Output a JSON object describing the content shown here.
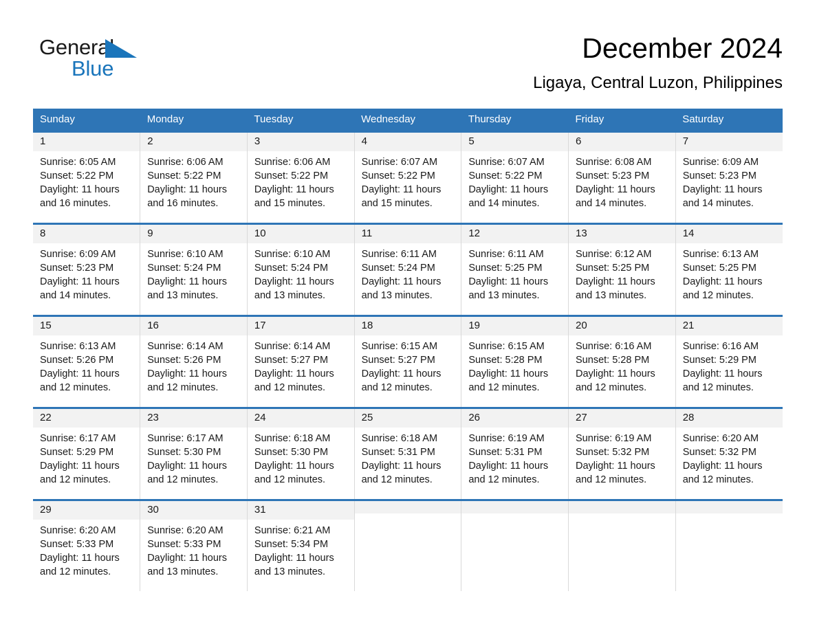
{
  "logo": {
    "word1": "General",
    "word2": "Blue",
    "triangle_color": "#1a75bb",
    "text_color": "#1a1a1a"
  },
  "header": {
    "month_title": "December 2024",
    "location": "Ligaya, Central Luzon, Philippines"
  },
  "colors": {
    "header_blue": "#2e75b6",
    "date_band_gray": "#f2f2f2",
    "cell_border": "#d9d9d9"
  },
  "calendar": {
    "day_headers": [
      "Sunday",
      "Monday",
      "Tuesday",
      "Wednesday",
      "Thursday",
      "Friday",
      "Saturday"
    ],
    "weeks": [
      [
        {
          "date": "1",
          "sunrise": "Sunrise: 6:05 AM",
          "sunset": "Sunset: 5:22 PM",
          "daylight_l1": "Daylight: 11 hours",
          "daylight_l2": "and 16 minutes."
        },
        {
          "date": "2",
          "sunrise": "Sunrise: 6:06 AM",
          "sunset": "Sunset: 5:22 PM",
          "daylight_l1": "Daylight: 11 hours",
          "daylight_l2": "and 16 minutes."
        },
        {
          "date": "3",
          "sunrise": "Sunrise: 6:06 AM",
          "sunset": "Sunset: 5:22 PM",
          "daylight_l1": "Daylight: 11 hours",
          "daylight_l2": "and 15 minutes."
        },
        {
          "date": "4",
          "sunrise": "Sunrise: 6:07 AM",
          "sunset": "Sunset: 5:22 PM",
          "daylight_l1": "Daylight: 11 hours",
          "daylight_l2": "and 15 minutes."
        },
        {
          "date": "5",
          "sunrise": "Sunrise: 6:07 AM",
          "sunset": "Sunset: 5:22 PM",
          "daylight_l1": "Daylight: 11 hours",
          "daylight_l2": "and 14 minutes."
        },
        {
          "date": "6",
          "sunrise": "Sunrise: 6:08 AM",
          "sunset": "Sunset: 5:23 PM",
          "daylight_l1": "Daylight: 11 hours",
          "daylight_l2": "and 14 minutes."
        },
        {
          "date": "7",
          "sunrise": "Sunrise: 6:09 AM",
          "sunset": "Sunset: 5:23 PM",
          "daylight_l1": "Daylight: 11 hours",
          "daylight_l2": "and 14 minutes."
        }
      ],
      [
        {
          "date": "8",
          "sunrise": "Sunrise: 6:09 AM",
          "sunset": "Sunset: 5:23 PM",
          "daylight_l1": "Daylight: 11 hours",
          "daylight_l2": "and 14 minutes."
        },
        {
          "date": "9",
          "sunrise": "Sunrise: 6:10 AM",
          "sunset": "Sunset: 5:24 PM",
          "daylight_l1": "Daylight: 11 hours",
          "daylight_l2": "and 13 minutes."
        },
        {
          "date": "10",
          "sunrise": "Sunrise: 6:10 AM",
          "sunset": "Sunset: 5:24 PM",
          "daylight_l1": "Daylight: 11 hours",
          "daylight_l2": "and 13 minutes."
        },
        {
          "date": "11",
          "sunrise": "Sunrise: 6:11 AM",
          "sunset": "Sunset: 5:24 PM",
          "daylight_l1": "Daylight: 11 hours",
          "daylight_l2": "and 13 minutes."
        },
        {
          "date": "12",
          "sunrise": "Sunrise: 6:11 AM",
          "sunset": "Sunset: 5:25 PM",
          "daylight_l1": "Daylight: 11 hours",
          "daylight_l2": "and 13 minutes."
        },
        {
          "date": "13",
          "sunrise": "Sunrise: 6:12 AM",
          "sunset": "Sunset: 5:25 PM",
          "daylight_l1": "Daylight: 11 hours",
          "daylight_l2": "and 13 minutes."
        },
        {
          "date": "14",
          "sunrise": "Sunrise: 6:13 AM",
          "sunset": "Sunset: 5:25 PM",
          "daylight_l1": "Daylight: 11 hours",
          "daylight_l2": "and 12 minutes."
        }
      ],
      [
        {
          "date": "15",
          "sunrise": "Sunrise: 6:13 AM",
          "sunset": "Sunset: 5:26 PM",
          "daylight_l1": "Daylight: 11 hours",
          "daylight_l2": "and 12 minutes."
        },
        {
          "date": "16",
          "sunrise": "Sunrise: 6:14 AM",
          "sunset": "Sunset: 5:26 PM",
          "daylight_l1": "Daylight: 11 hours",
          "daylight_l2": "and 12 minutes."
        },
        {
          "date": "17",
          "sunrise": "Sunrise: 6:14 AM",
          "sunset": "Sunset: 5:27 PM",
          "daylight_l1": "Daylight: 11 hours",
          "daylight_l2": "and 12 minutes."
        },
        {
          "date": "18",
          "sunrise": "Sunrise: 6:15 AM",
          "sunset": "Sunset: 5:27 PM",
          "daylight_l1": "Daylight: 11 hours",
          "daylight_l2": "and 12 minutes."
        },
        {
          "date": "19",
          "sunrise": "Sunrise: 6:15 AM",
          "sunset": "Sunset: 5:28 PM",
          "daylight_l1": "Daylight: 11 hours",
          "daylight_l2": "and 12 minutes."
        },
        {
          "date": "20",
          "sunrise": "Sunrise: 6:16 AM",
          "sunset": "Sunset: 5:28 PM",
          "daylight_l1": "Daylight: 11 hours",
          "daylight_l2": "and 12 minutes."
        },
        {
          "date": "21",
          "sunrise": "Sunrise: 6:16 AM",
          "sunset": "Sunset: 5:29 PM",
          "daylight_l1": "Daylight: 11 hours",
          "daylight_l2": "and 12 minutes."
        }
      ],
      [
        {
          "date": "22",
          "sunrise": "Sunrise: 6:17 AM",
          "sunset": "Sunset: 5:29 PM",
          "daylight_l1": "Daylight: 11 hours",
          "daylight_l2": "and 12 minutes."
        },
        {
          "date": "23",
          "sunrise": "Sunrise: 6:17 AM",
          "sunset": "Sunset: 5:30 PM",
          "daylight_l1": "Daylight: 11 hours",
          "daylight_l2": "and 12 minutes."
        },
        {
          "date": "24",
          "sunrise": "Sunrise: 6:18 AM",
          "sunset": "Sunset: 5:30 PM",
          "daylight_l1": "Daylight: 11 hours",
          "daylight_l2": "and 12 minutes."
        },
        {
          "date": "25",
          "sunrise": "Sunrise: 6:18 AM",
          "sunset": "Sunset: 5:31 PM",
          "daylight_l1": "Daylight: 11 hours",
          "daylight_l2": "and 12 minutes."
        },
        {
          "date": "26",
          "sunrise": "Sunrise: 6:19 AM",
          "sunset": "Sunset: 5:31 PM",
          "daylight_l1": "Daylight: 11 hours",
          "daylight_l2": "and 12 minutes."
        },
        {
          "date": "27",
          "sunrise": "Sunrise: 6:19 AM",
          "sunset": "Sunset: 5:32 PM",
          "daylight_l1": "Daylight: 11 hours",
          "daylight_l2": "and 12 minutes."
        },
        {
          "date": "28",
          "sunrise": "Sunrise: 6:20 AM",
          "sunset": "Sunset: 5:32 PM",
          "daylight_l1": "Daylight: 11 hours",
          "daylight_l2": "and 12 minutes."
        }
      ],
      [
        {
          "date": "29",
          "sunrise": "Sunrise: 6:20 AM",
          "sunset": "Sunset: 5:33 PM",
          "daylight_l1": "Daylight: 11 hours",
          "daylight_l2": "and 12 minutes."
        },
        {
          "date": "30",
          "sunrise": "Sunrise: 6:20 AM",
          "sunset": "Sunset: 5:33 PM",
          "daylight_l1": "Daylight: 11 hours",
          "daylight_l2": "and 13 minutes."
        },
        {
          "date": "31",
          "sunrise": "Sunrise: 6:21 AM",
          "sunset": "Sunset: 5:34 PM",
          "daylight_l1": "Daylight: 11 hours",
          "daylight_l2": "and 13 minutes."
        },
        {
          "date": "",
          "sunrise": "",
          "sunset": "",
          "daylight_l1": "",
          "daylight_l2": ""
        },
        {
          "date": "",
          "sunrise": "",
          "sunset": "",
          "daylight_l1": "",
          "daylight_l2": ""
        },
        {
          "date": "",
          "sunrise": "",
          "sunset": "",
          "daylight_l1": "",
          "daylight_l2": ""
        },
        {
          "date": "",
          "sunrise": "",
          "sunset": "",
          "daylight_l1": "",
          "daylight_l2": ""
        }
      ]
    ]
  }
}
